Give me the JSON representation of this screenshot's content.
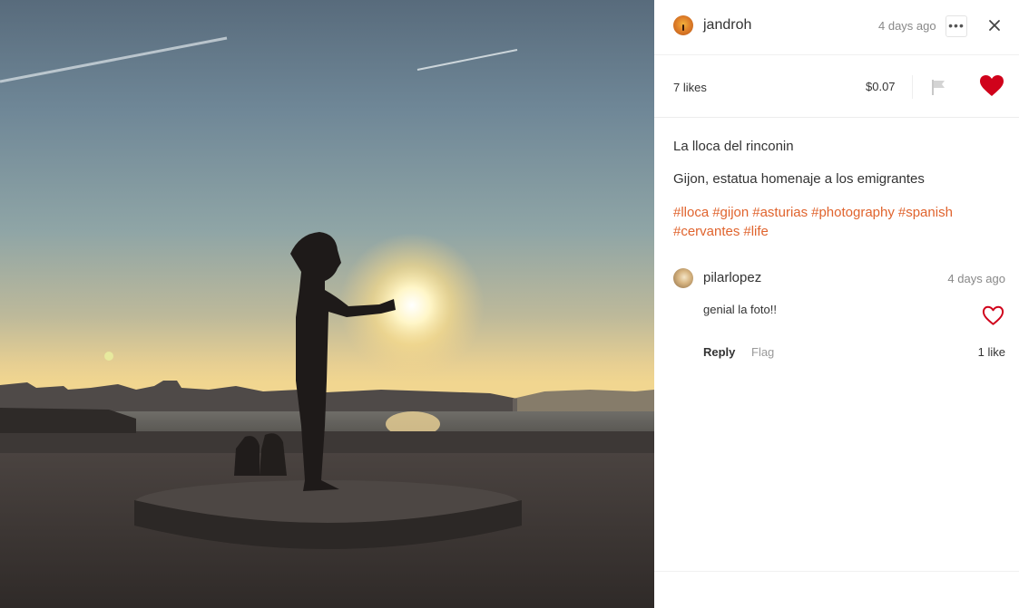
{
  "photo": {
    "subject": "statue-silhouette-at-sunset"
  },
  "post": {
    "author": "jandroh",
    "time": "4 days ago",
    "more_label": "•••",
    "likes": "7 likes",
    "payout": "$0.07",
    "title": "La lloca del rinconin",
    "body": "Gijon, estatua homenaje a los emigrantes",
    "tags": [
      "#lloca",
      "#gijon",
      "#asturias",
      "#photography",
      "#spanish",
      "#cervantes",
      "#life"
    ],
    "liked": true
  },
  "comment": {
    "author": "pilarlopez",
    "time": "4 days ago",
    "text": "genial la foto!!",
    "reply_label": "Reply",
    "flag_label": "Flag",
    "likes": "1 like"
  },
  "colors": {
    "accent": "#e0642e",
    "heart": "#d0021b",
    "text": "#333333",
    "muted": "#888888"
  },
  "icons": [
    "more-icon",
    "close-icon",
    "flag-icon",
    "heart-filled-icon",
    "heart-outline-icon"
  ]
}
